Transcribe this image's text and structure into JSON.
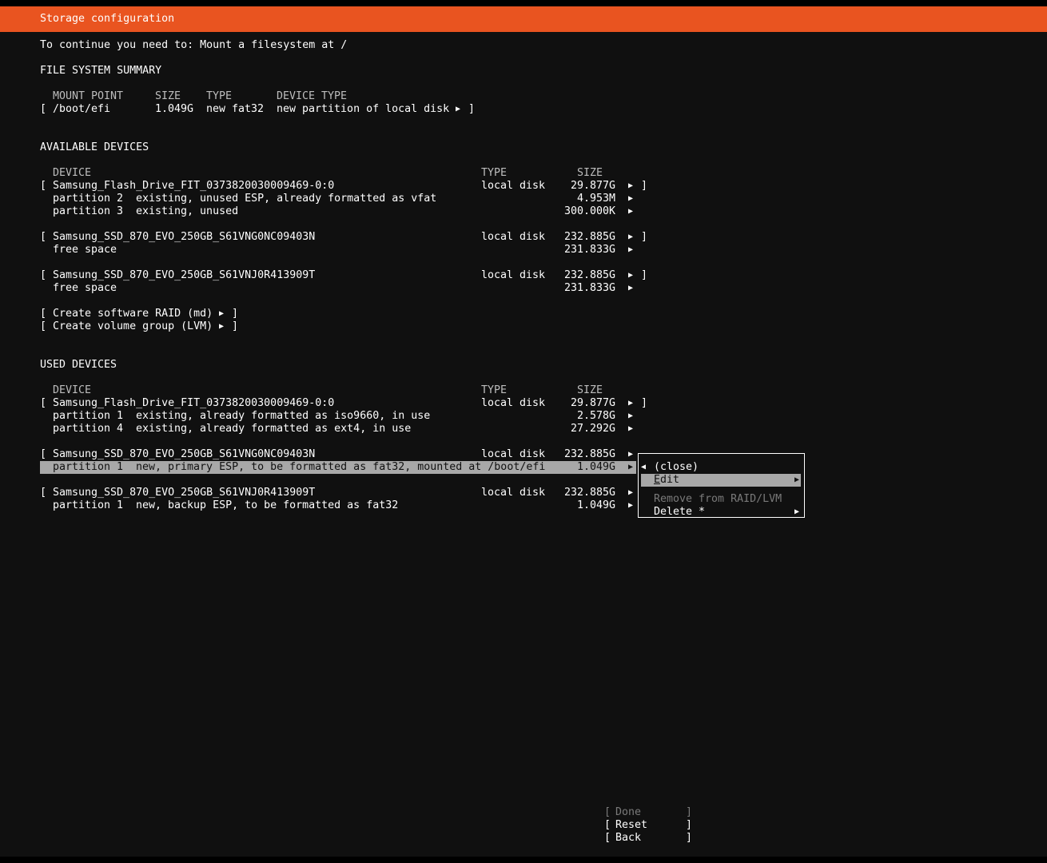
{
  "title": "Storage configuration",
  "notice": "To continue you need to: Mount a filesystem at /",
  "fs_summary": {
    "heading": "FILE SYSTEM SUMMARY",
    "col_mount": "MOUNT POINT",
    "col_size": "SIZE",
    "col_type": "TYPE",
    "col_devtype": "DEVICE TYPE",
    "row": {
      "mount": "/boot/efi",
      "size": "1.049G",
      "type": "new fat32",
      "devtype": "new partition of local disk"
    }
  },
  "available": {
    "heading": "AVAILABLE DEVICES",
    "col_device": "DEVICE",
    "col_type": "TYPE",
    "col_size": "SIZE",
    "disk1": {
      "name": "Samsung_Flash_Drive_FIT_0373820030009469-0:0",
      "type": "local disk",
      "size": "29.877G",
      "p2_label": "partition 2",
      "p2_desc": "existing, unused ESP, already formatted as vfat",
      "p2_size": "4.953M",
      "p3_label": "partition 3",
      "p3_desc": "existing, unused",
      "p3_size": "300.000K"
    },
    "disk2": {
      "name": "Samsung_SSD_870_EVO_250GB_S61VNG0NC09403N",
      "type": "local disk",
      "size": "232.885G",
      "free_label": "free space",
      "free_size": "231.833G"
    },
    "disk3": {
      "name": "Samsung_SSD_870_EVO_250GB_S61VNJ0R413909T",
      "type": "local disk",
      "size": "232.885G",
      "free_label": "free space",
      "free_size": "231.833G"
    },
    "create_raid": "Create software RAID (md)",
    "create_lvm": "Create volume group (LVM)"
  },
  "used": {
    "heading": "USED DEVICES",
    "col_device": "DEVICE",
    "col_type": "TYPE",
    "col_size": "SIZE",
    "disk1": {
      "name": "Samsung_Flash_Drive_FIT_0373820030009469-0:0",
      "type": "local disk",
      "size": "29.877G",
      "p1_label": "partition 1",
      "p1_desc": "existing, already formatted as iso9660, in use",
      "p1_size": "2.578G",
      "p4_label": "partition 4",
      "p4_desc": "existing, already formatted as ext4, in use",
      "p4_size": "27.292G"
    },
    "disk2": {
      "name": "Samsung_SSD_870_EVO_250GB_S61VNG0NC09403N",
      "type": "local disk",
      "size": "232.885G",
      "p1_label": "partition 1",
      "p1_desc": "new, primary ESP, to be formatted as fat32, mounted at /boot/efi",
      "p1_size": "1.049G"
    },
    "disk3": {
      "name": "Samsung_SSD_870_EVO_250GB_S61VNJ0R413909T",
      "type": "local disk",
      "size": "232.885G",
      "p1_label": "partition 1",
      "p1_desc": "new, backup ESP, to be formatted as fat32",
      "p1_size": "1.049G"
    }
  },
  "menu": {
    "close": "(close)",
    "edit_first": "E",
    "edit_rest": "dit",
    "remove": "Remove from RAID/LVM",
    "delete": "Delete *"
  },
  "footer": {
    "done": "Done",
    "reset": "Reset",
    "back": "Back"
  },
  "colors": {
    "accent": "#e95420",
    "background": "#101010",
    "selection": "#a8a8a8"
  },
  "icons": {
    "expand": "triangle-right-icon",
    "collapse": "triangle-left-icon"
  }
}
